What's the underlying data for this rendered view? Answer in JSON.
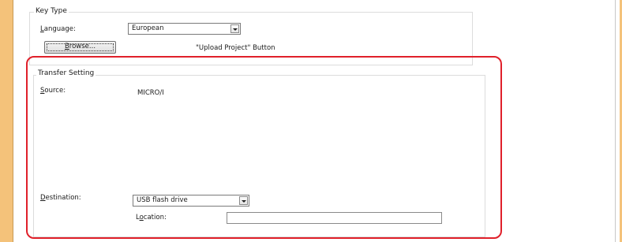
{
  "key_type": {
    "group_title": "Key Type",
    "language_label_prefix": "",
    "language_label_accel": "L",
    "language_label_rest": "anguage:",
    "language_value": "European",
    "browse_label_accel": "B",
    "browse_label_rest": "rowse...",
    "upload_project_text": "\"Upload Project\" Button"
  },
  "transfer": {
    "group_title": "Transfer Setting",
    "source_label_accel": "S",
    "source_label_rest": "ource:",
    "source_value": "MICRO/I",
    "destination_label_accel": "D",
    "destination_label_rest": "estination:",
    "destination_value": "USB flash drive",
    "location_label_prefix": "L",
    "location_label_accel": "o",
    "location_label_rest": "cation:",
    "location_value": ""
  },
  "colors": {
    "highlight": "#e0202a",
    "accent_strip": "#f4c27a"
  }
}
